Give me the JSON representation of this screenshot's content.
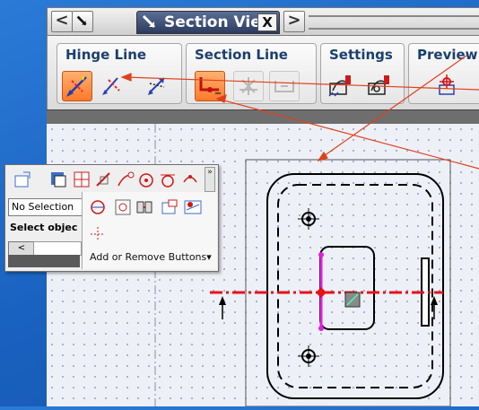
{
  "dialog": {
    "tab_title": "Section View",
    "nav_prev": "<",
    "nav_next": ">",
    "close": "X"
  },
  "ribbon": {
    "groups": [
      {
        "title": "Hinge Line"
      },
      {
        "title": "Section Line"
      },
      {
        "title": "Settings"
      },
      {
        "title": "Preview"
      }
    ]
  },
  "floating_toolbar": {
    "selection_value": "No Selection",
    "select_label": "Select objec",
    "add_remove_label": "Add or Remove Buttons",
    "add_remove_arrow": "▾",
    "overflow": "»",
    "scroll_left": "<"
  },
  "colors": {
    "section_line": "#e8101a",
    "hinge_marker": "#e020e0",
    "annotation_arrows": "#e0401a",
    "active_button": "#ff8a3a"
  }
}
